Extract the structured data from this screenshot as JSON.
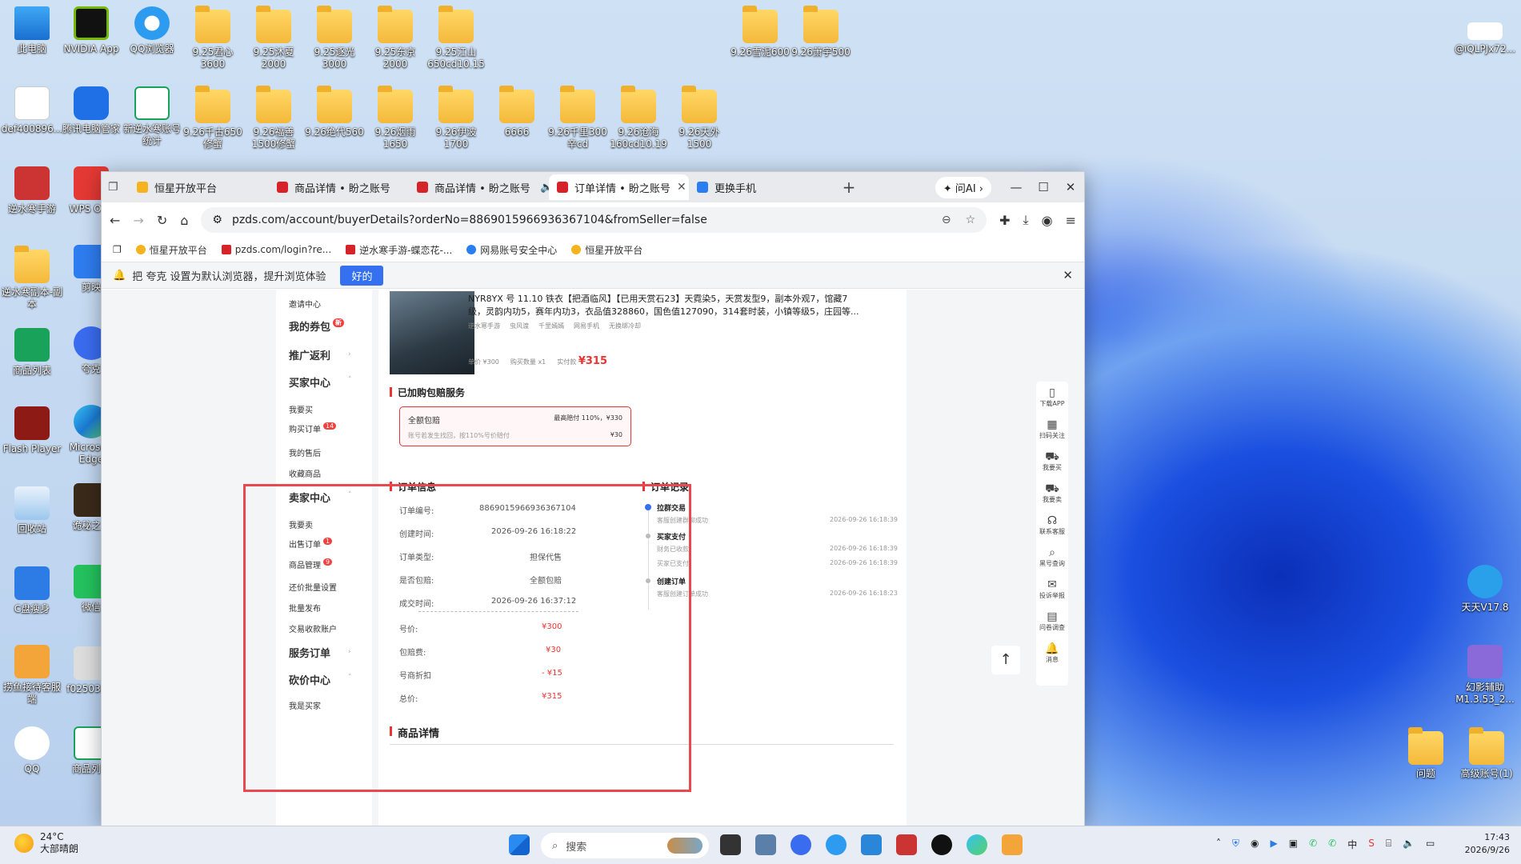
{
  "desktop_icons": {
    "row1": [
      {
        "label": "此电脑",
        "kind": "app"
      },
      {
        "label": "NVIDIA App",
        "kind": "app"
      },
      {
        "label": "QQ浏览器",
        "kind": "app"
      },
      {
        "label": "9.25君心3600",
        "kind": "folder"
      },
      {
        "label": "9.25沐夏2000",
        "kind": "folder"
      },
      {
        "label": "9.25逐光3000",
        "kind": "folder"
      },
      {
        "label": "9.25东京2000",
        "kind": "folder"
      },
      {
        "label": "9.25江山650cd10.15",
        "kind": "folder"
      }
    ],
    "row1_right": [
      {
        "label": "9.26雪泥600",
        "kind": "folder"
      },
      {
        "label": "9.26萧宇500",
        "kind": "folder"
      }
    ],
    "row2": [
      {
        "label": "def400896...",
        "kind": "app"
      },
      {
        "label": "腾讯电脑管家",
        "kind": "app"
      },
      {
        "label": "新逆水寒账号统计",
        "kind": "app"
      },
      {
        "label": "9.26千古650修蟹",
        "kind": "folder"
      },
      {
        "label": "9.26福善1500修蟹",
        "kind": "folder"
      },
      {
        "label": "9.26绝代560",
        "kind": "folder"
      },
      {
        "label": "9.26烟雨1650",
        "kind": "folder"
      },
      {
        "label": "9.26伊波1700",
        "kind": "folder"
      },
      {
        "label": "6666",
        "kind": "folder"
      },
      {
        "label": "9.26千里300辛cd",
        "kind": "folder"
      },
      {
        "label": "9.26沧海160cd10.19",
        "kind": "folder"
      },
      {
        "label": "9.26天外1500",
        "kind": "folder"
      }
    ],
    "left_col": [
      {
        "label": "逆水寒手游",
        "kind": "app"
      },
      {
        "label": "逆水寒副本-副本",
        "kind": "folder"
      },
      {
        "label": "商品列表",
        "kind": "app"
      },
      {
        "label": "Flash Player",
        "kind": "app"
      },
      {
        "label": "回收站",
        "kind": "app"
      },
      {
        "label": "C盘瘦身",
        "kind": "app"
      },
      {
        "label": "捞鱼接待客服端",
        "kind": "app"
      },
      {
        "label": "QQ",
        "kind": "app"
      }
    ],
    "left_col2": [
      {
        "label": "WPS Of...",
        "kind": "app"
      },
      {
        "label": "剪映",
        "kind": "app"
      },
      {
        "label": "夸克",
        "kind": "app"
      },
      {
        "label": "Microsoft Edge",
        "kind": "app"
      },
      {
        "label": "诡秘之...",
        "kind": "app"
      },
      {
        "label": "微信",
        "kind": "app"
      },
      {
        "label": "f025032...",
        "kind": "app"
      },
      {
        "label": "商品列表",
        "kind": "app"
      }
    ],
    "right_col": [
      {
        "label": "@iQLPJx72...",
        "kind": "app"
      },
      {
        "label": "天天V17.8",
        "kind": "app"
      },
      {
        "label": "幻影辅助M1.3.53_2...",
        "kind": "app"
      },
      {
        "label": "问题",
        "kind": "folder"
      },
      {
        "label": "高级账号(1)",
        "kind": "folder"
      }
    ]
  },
  "browser": {
    "tabs": [
      {
        "label": "恒星开放平台",
        "fav": "fav-yel",
        "active": false
      },
      {
        "label": "商品详情 • 盼之账号",
        "fav": "fav-red",
        "active": false
      },
      {
        "label": "商品详情 • 盼之账号",
        "fav": "fav-red",
        "active": false
      },
      {
        "label": "订单详情 • 盼之账号",
        "fav": "fav-red",
        "active": true
      },
      {
        "label": "更换手机",
        "fav": "fav-blue",
        "active": false
      }
    ],
    "ask_ai": "问AI",
    "url": "pzds.com/account/buyerDetails?orderNo=8869015966936367104&fromSeller=false",
    "bookmarks": [
      "恒星开放平台",
      "pzds.com/login?re...",
      "逆水寒手游-蝶恋花-...",
      "网易账号安全中心",
      "恒星开放平台"
    ],
    "notice_text": "把 夸克 设置为默认浏览器，提升浏览体验",
    "notice_ok": "好的"
  },
  "sidemenu": [
    {
      "label": "邀请中心",
      "big": false,
      "badge": ""
    },
    {
      "label": "我的券包",
      "big": true,
      "badge": "新"
    },
    {
      "label": "推广返利",
      "big": true,
      "badge": ""
    },
    {
      "label": "买家中心",
      "big": true,
      "badge": ""
    },
    {
      "label": "我要买",
      "big": false,
      "badge": ""
    },
    {
      "label": "购买订单",
      "big": false,
      "badge": "14"
    },
    {
      "label": "我的售后",
      "big": false,
      "badge": ""
    },
    {
      "label": "收藏商品",
      "big": false,
      "badge": ""
    },
    {
      "label": "卖家中心",
      "big": true,
      "badge": ""
    },
    {
      "label": "我要卖",
      "big": false,
      "badge": ""
    },
    {
      "label": "出售订单",
      "big": false,
      "badge": "1"
    },
    {
      "label": "商品管理",
      "big": false,
      "badge": "9"
    },
    {
      "label": "还价批量设置",
      "big": false,
      "badge": ""
    },
    {
      "label": "批量发布",
      "big": false,
      "badge": ""
    },
    {
      "label": "交易收款账户",
      "big": false,
      "badge": ""
    },
    {
      "label": "服务订单",
      "big": true,
      "badge": ""
    },
    {
      "label": "砍价中心",
      "big": true,
      "badge": ""
    },
    {
      "label": "我是买家",
      "big": false,
      "badge": ""
    }
  ],
  "product": {
    "title_line1": "NYR8YX 号 11.10 铁衣【把酒临风】【已用天赏石23】天霓染5，天赏发型9，副本外观7，馆藏7",
    "title_line2": "级，灵韵内功5，赛年内功3，衣品值328860，国色值127090，314套时装，小镇等级5，庄园等...",
    "tags": [
      "逆水寒手游",
      "虫风渡",
      "千里嫣嫣",
      "网易手机",
      "无换绑冷却"
    ],
    "unit_price": "单价 ¥300",
    "qty": "购买数量 x1",
    "paid_label": "实付款",
    "paid": "¥315"
  },
  "insurance": {
    "section_title": "已加购包赔服务",
    "name": "全额包赔",
    "max": "最高赔付 110%，¥330",
    "desc": "账号若发生找回，按110%号价赔付",
    "price": "¥30"
  },
  "order_info": {
    "title": "订单信息",
    "rows": [
      {
        "k": "订单编号:",
        "v": "8869015966936367104"
      },
      {
        "k": "创建时间:",
        "v": "2026-09-26 16:18:22"
      },
      {
        "k": "订单类型:",
        "v": "担保代售"
      },
      {
        "k": "是否包赔:",
        "v": "全额包赔"
      },
      {
        "k": "成交时间:",
        "v": "2026-09-26 16:37:12"
      }
    ],
    "price_rows": [
      {
        "k": "号价:",
        "v": "¥300"
      },
      {
        "k": "包赔费:",
        "v": "¥30"
      },
      {
        "k": "号商折扣",
        "v": "- ¥15"
      },
      {
        "k": "总价:",
        "v": "¥315"
      }
    ]
  },
  "order_log": {
    "title": "订单记录",
    "items": [
      {
        "title": "拉群交易",
        "sub": "客服创建群聊成功",
        "time": "2026-09-26 16:18:39"
      },
      {
        "title": "买家支付",
        "sub": "财务已收款",
        "time": "2026-09-26 16:18:39"
      },
      {
        "title": "",
        "sub": "买家已支付",
        "time": "2026-09-26 16:18:39"
      },
      {
        "title": "创建订单",
        "sub": "客服创建订单成功",
        "time": "2026-09-26 16:18:23"
      }
    ]
  },
  "product_detail_title": "商品详情",
  "rightbar": [
    "下载APP",
    "扫码关注",
    "我要买",
    "我要卖",
    "联系客服",
    "黑号查询",
    "投诉举报",
    "问卷调查",
    "消息"
  ],
  "taskbar": {
    "temp": "24°C",
    "weather": "大部晴朗",
    "search": "搜索",
    "time": "17:43",
    "date": "2026/9/26",
    "ime": "中"
  },
  "colors": {
    "accent": "#3470ef",
    "red": "#e33",
    "highlight_box": "#e8484e"
  }
}
